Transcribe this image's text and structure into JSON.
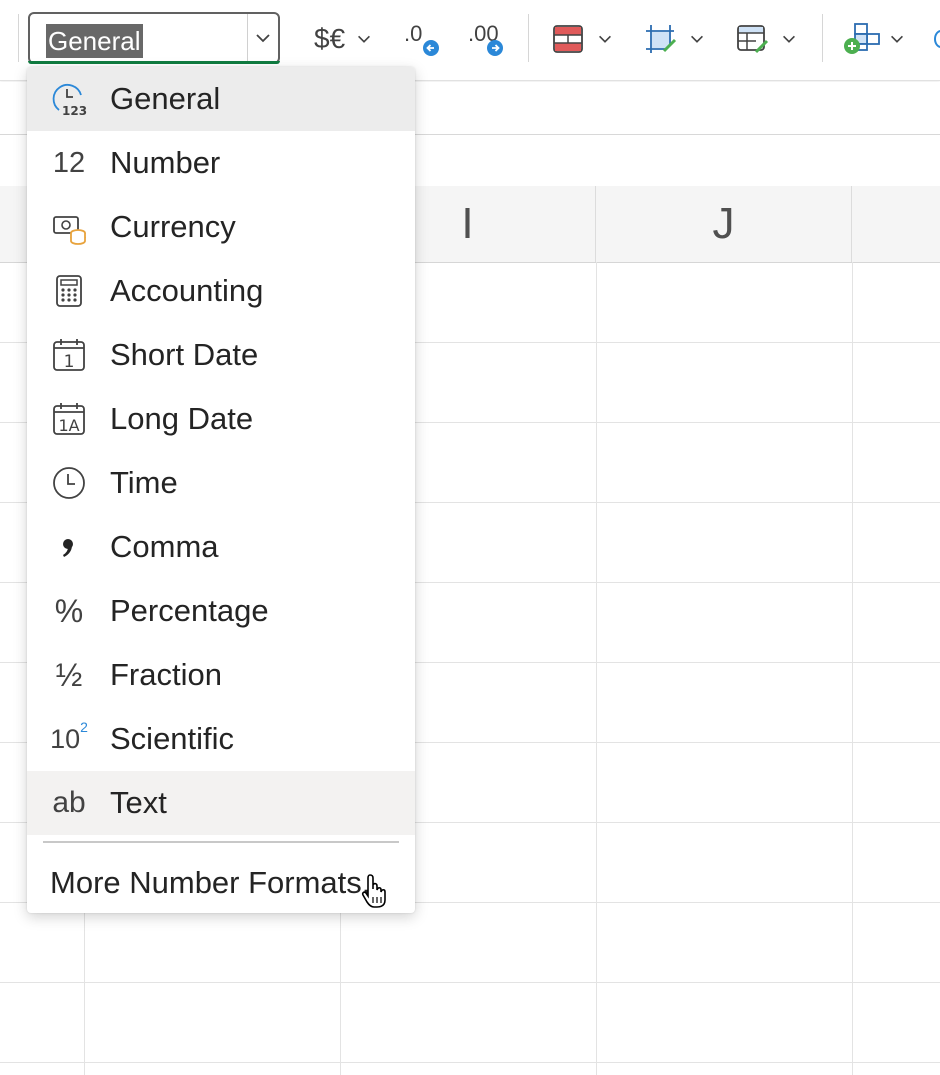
{
  "ribbon": {
    "number_format_value": "General",
    "currency_button": {
      "label": "$€",
      "icon": "currency-icon"
    },
    "decrease_decimal": {
      "label": ".0",
      "icon": "decrease-decimal-icon"
    },
    "increase_decimal": {
      "label": ".00",
      "icon": "increase-decimal-icon"
    },
    "conditional_format": {
      "icon": "conditional-formatting-icon"
    },
    "borders": {
      "icon": "borders-icon"
    },
    "format_as_table": {
      "icon": "format-as-table-icon"
    },
    "insert_cells": {
      "icon": "insert-cells-icon"
    }
  },
  "grid": {
    "column_headers": [
      "I",
      "J"
    ]
  },
  "dropdown": {
    "items": [
      {
        "label": "General",
        "icon": "general-format-icon",
        "state": "selected"
      },
      {
        "label": "Number",
        "icon": "number-format-icon",
        "glyph": "12"
      },
      {
        "label": "Currency",
        "icon": "currency-format-icon"
      },
      {
        "label": "Accounting",
        "icon": "accounting-calculator-icon"
      },
      {
        "label": "Short Date",
        "icon": "short-date-calendar-icon",
        "glyph": "1"
      },
      {
        "label": "Long Date",
        "icon": "long-date-calendar-icon",
        "glyph": "1A"
      },
      {
        "label": "Time",
        "icon": "clock-icon"
      },
      {
        "label": "Comma",
        "icon": "comma-icon"
      },
      {
        "label": "Percentage",
        "icon": "percent-icon",
        "glyph": "%"
      },
      {
        "label": "Fraction",
        "icon": "fraction-icon",
        "glyph": "½"
      },
      {
        "label": "Scientific",
        "icon": "scientific-icon",
        "glyph": "10",
        "glyph_sup": "2"
      },
      {
        "label": "Text",
        "icon": "text-format-icon",
        "glyph": "ab",
        "state": "hovered"
      }
    ],
    "more_label": "More Number Formats..."
  },
  "colors": {
    "accent_green": "#107c41",
    "selection_gray": "#686868",
    "icon_blue": "#2b88d8",
    "icon_orange": "#e8a33d",
    "icon_red": "#e05a5a"
  }
}
